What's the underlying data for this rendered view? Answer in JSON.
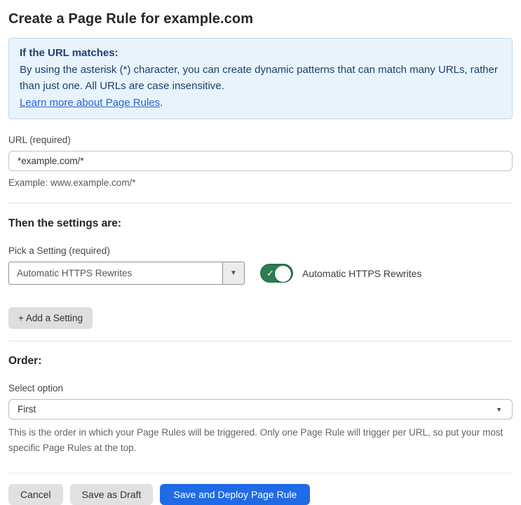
{
  "page": {
    "title": "Create a Page Rule for example.com"
  },
  "info_box": {
    "heading": "If the URL matches:",
    "body": "By using the asterisk (*) character, you can create dynamic patterns that can match many URLs, rather than just one. All URLs are case insensitive.",
    "link_label": "Learn more about Page Rules",
    "link_suffix": "."
  },
  "url_field": {
    "label": "URL (required)",
    "value": "*example.com/*",
    "helper": "Example: www.example.com/*"
  },
  "settings_section": {
    "heading": "Then the settings are:",
    "picker_label": "Pick a Setting (required)",
    "picker_value": "Automatic HTTPS Rewrites",
    "toggle_state": "on",
    "toggle_label": "Automatic HTTPS Rewrites",
    "add_button_label": "+ Add a Setting"
  },
  "order_section": {
    "heading": "Order:",
    "select_label": "Select option",
    "select_value": "First",
    "helper": "This is the order in which your Page Rules will be triggered. Only one Page Rule will trigger per URL, so put your most specific Page Rules at the top."
  },
  "footer": {
    "cancel_label": "Cancel",
    "save_draft_label": "Save as Draft",
    "save_deploy_label": "Save and Deploy Page Rule"
  },
  "icons": {
    "caret_down": "▼",
    "check": "✓"
  },
  "colors": {
    "info_bg": "#e9f3fc",
    "info_border": "#b9d9f3",
    "info_text": "#1d3f72",
    "link": "#2762d9",
    "toggle_on": "#2e7d53",
    "primary_button": "#1f6be6",
    "secondary_button": "#e1e1e1"
  }
}
